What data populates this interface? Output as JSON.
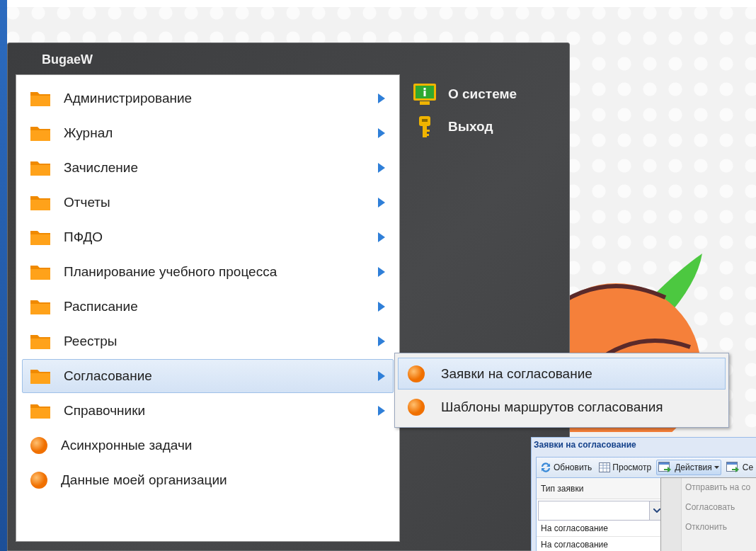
{
  "user": "BugaeW",
  "menu_items": [
    {
      "kind": "folder",
      "label": "Администрирование",
      "has_submenu": true,
      "selected": false
    },
    {
      "kind": "folder",
      "label": "Журнал",
      "has_submenu": true,
      "selected": false
    },
    {
      "kind": "folder",
      "label": "Зачисление",
      "has_submenu": true,
      "selected": false
    },
    {
      "kind": "folder",
      "label": "Отчеты",
      "has_submenu": true,
      "selected": false
    },
    {
      "kind": "folder",
      "label": "ПФДО",
      "has_submenu": true,
      "selected": false
    },
    {
      "kind": "folder",
      "label": "Планирование учебного процесса",
      "has_submenu": true,
      "selected": false
    },
    {
      "kind": "folder",
      "label": "Расписание",
      "has_submenu": true,
      "selected": false
    },
    {
      "kind": "folder",
      "label": "Реестры",
      "has_submenu": true,
      "selected": false
    },
    {
      "kind": "folder",
      "label": "Согласование",
      "has_submenu": true,
      "selected": true
    },
    {
      "kind": "folder",
      "label": "Справочники",
      "has_submenu": true,
      "selected": false
    },
    {
      "kind": "task",
      "label": "Асинхронные задачи",
      "has_submenu": false,
      "selected": false
    },
    {
      "kind": "task",
      "label": "Данные моей организации",
      "has_submenu": false,
      "selected": false
    }
  ],
  "side_links": [
    {
      "kind": "monitor",
      "label": "О системе"
    },
    {
      "kind": "key",
      "label": "Выход"
    }
  ],
  "submenu": [
    {
      "label": "Заявки на согласование",
      "selected": true
    },
    {
      "label": "Шаблоны маршрутов согласования",
      "selected": false
    }
  ],
  "inset_window": {
    "title": "Заявки на согласование",
    "toolbar": [
      {
        "kind": "refresh",
        "label": "Обновить",
        "pressed": false,
        "dropdown": false
      },
      {
        "kind": "grid",
        "label": "Просмотр",
        "pressed": false,
        "dropdown": false
      },
      {
        "kind": "export",
        "label": "Действия",
        "pressed": true,
        "dropdown": true
      },
      {
        "kind": "export",
        "label": "Се",
        "pressed": false,
        "dropdown": false
      }
    ],
    "column_header": "Тип заявки",
    "rows": [
      "На согласование",
      "На согласование"
    ],
    "dropdown_items": [
      {
        "label": "Отправить на со",
        "disabled": true
      },
      {
        "label": "Согласовать",
        "disabled": true
      },
      {
        "label": "Отклонить",
        "disabled": true
      }
    ]
  }
}
